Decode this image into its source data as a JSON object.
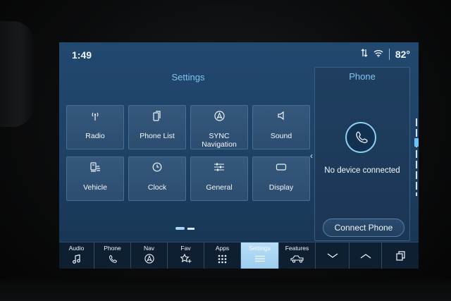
{
  "status": {
    "time": "1:49",
    "temperature": "82°",
    "icons": [
      "data-transfer-icon",
      "wifi-icon"
    ]
  },
  "settings": {
    "title": "Settings",
    "tiles": [
      {
        "label": "Radio",
        "icon": "radio-antenna-icon"
      },
      {
        "label": "Phone List",
        "icon": "phone-list-icon"
      },
      {
        "label": "SYNC Navigation",
        "icon": "navigation-icon"
      },
      {
        "label": "Sound",
        "icon": "speaker-icon"
      },
      {
        "label": "Vehicle",
        "icon": "vehicle-settings-icon"
      },
      {
        "label": "Clock",
        "icon": "clock-icon"
      },
      {
        "label": "General",
        "icon": "sliders-icon"
      },
      {
        "label": "Display",
        "icon": "display-icon"
      }
    ]
  },
  "phone_panel": {
    "title": "Phone",
    "message": "No device connected",
    "connect_label": "Connect Phone",
    "icon": "phone-icon"
  },
  "navbar": {
    "items": [
      {
        "label": "Audio",
        "icon": "music-note-icon"
      },
      {
        "label": "Phone",
        "icon": "phone-icon"
      },
      {
        "label": "Nav",
        "icon": "navigation-icon"
      },
      {
        "label": "Fav",
        "icon": "star-plus-icon"
      },
      {
        "label": "Apps",
        "icon": "apps-grid-icon"
      },
      {
        "label": "Settings",
        "icon": "settings-lines-icon",
        "active": true
      },
      {
        "label": "Features",
        "icon": "truck-icon"
      },
      {
        "label": "",
        "icon": "chevron-down-icon"
      },
      {
        "label": "",
        "icon": "chevron-up-icon"
      },
      {
        "label": "",
        "icon": "copy-screens-icon"
      }
    ]
  },
  "colors": {
    "accent": "#7fc4f2",
    "screen_bg": "#1e4267",
    "tile_bg": "#2f5275",
    "active_tab": "#a8d4f4"
  }
}
